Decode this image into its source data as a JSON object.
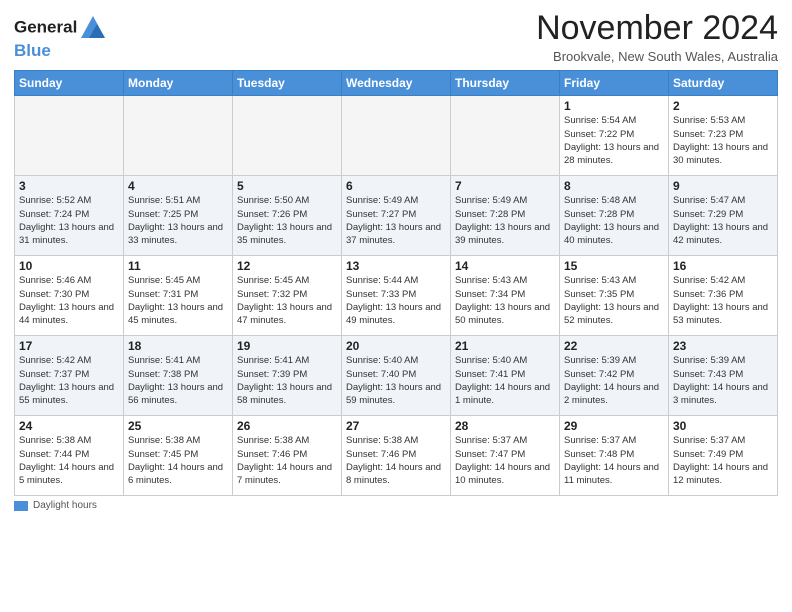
{
  "header": {
    "logo_line1": "General",
    "logo_line2": "Blue",
    "month_title": "November 2024",
    "location": "Brookvale, New South Wales, Australia"
  },
  "calendar": {
    "weekdays": [
      "Sunday",
      "Monday",
      "Tuesday",
      "Wednesday",
      "Thursday",
      "Friday",
      "Saturday"
    ],
    "weeks": [
      [
        {
          "day": "",
          "info": ""
        },
        {
          "day": "",
          "info": ""
        },
        {
          "day": "",
          "info": ""
        },
        {
          "day": "",
          "info": ""
        },
        {
          "day": "",
          "info": ""
        },
        {
          "day": "1",
          "info": "Sunrise: 5:54 AM\nSunset: 7:22 PM\nDaylight: 13 hours and 28 minutes."
        },
        {
          "day": "2",
          "info": "Sunrise: 5:53 AM\nSunset: 7:23 PM\nDaylight: 13 hours and 30 minutes."
        }
      ],
      [
        {
          "day": "3",
          "info": "Sunrise: 5:52 AM\nSunset: 7:24 PM\nDaylight: 13 hours and 31 minutes."
        },
        {
          "day": "4",
          "info": "Sunrise: 5:51 AM\nSunset: 7:25 PM\nDaylight: 13 hours and 33 minutes."
        },
        {
          "day": "5",
          "info": "Sunrise: 5:50 AM\nSunset: 7:26 PM\nDaylight: 13 hours and 35 minutes."
        },
        {
          "day": "6",
          "info": "Sunrise: 5:49 AM\nSunset: 7:27 PM\nDaylight: 13 hours and 37 minutes."
        },
        {
          "day": "7",
          "info": "Sunrise: 5:49 AM\nSunset: 7:28 PM\nDaylight: 13 hours and 39 minutes."
        },
        {
          "day": "8",
          "info": "Sunrise: 5:48 AM\nSunset: 7:28 PM\nDaylight: 13 hours and 40 minutes."
        },
        {
          "day": "9",
          "info": "Sunrise: 5:47 AM\nSunset: 7:29 PM\nDaylight: 13 hours and 42 minutes."
        }
      ],
      [
        {
          "day": "10",
          "info": "Sunrise: 5:46 AM\nSunset: 7:30 PM\nDaylight: 13 hours and 44 minutes."
        },
        {
          "day": "11",
          "info": "Sunrise: 5:45 AM\nSunset: 7:31 PM\nDaylight: 13 hours and 45 minutes."
        },
        {
          "day": "12",
          "info": "Sunrise: 5:45 AM\nSunset: 7:32 PM\nDaylight: 13 hours and 47 minutes."
        },
        {
          "day": "13",
          "info": "Sunrise: 5:44 AM\nSunset: 7:33 PM\nDaylight: 13 hours and 49 minutes."
        },
        {
          "day": "14",
          "info": "Sunrise: 5:43 AM\nSunset: 7:34 PM\nDaylight: 13 hours and 50 minutes."
        },
        {
          "day": "15",
          "info": "Sunrise: 5:43 AM\nSunset: 7:35 PM\nDaylight: 13 hours and 52 minutes."
        },
        {
          "day": "16",
          "info": "Sunrise: 5:42 AM\nSunset: 7:36 PM\nDaylight: 13 hours and 53 minutes."
        }
      ],
      [
        {
          "day": "17",
          "info": "Sunrise: 5:42 AM\nSunset: 7:37 PM\nDaylight: 13 hours and 55 minutes."
        },
        {
          "day": "18",
          "info": "Sunrise: 5:41 AM\nSunset: 7:38 PM\nDaylight: 13 hours and 56 minutes."
        },
        {
          "day": "19",
          "info": "Sunrise: 5:41 AM\nSunset: 7:39 PM\nDaylight: 13 hours and 58 minutes."
        },
        {
          "day": "20",
          "info": "Sunrise: 5:40 AM\nSunset: 7:40 PM\nDaylight: 13 hours and 59 minutes."
        },
        {
          "day": "21",
          "info": "Sunrise: 5:40 AM\nSunset: 7:41 PM\nDaylight: 14 hours and 1 minute."
        },
        {
          "day": "22",
          "info": "Sunrise: 5:39 AM\nSunset: 7:42 PM\nDaylight: 14 hours and 2 minutes."
        },
        {
          "day": "23",
          "info": "Sunrise: 5:39 AM\nSunset: 7:43 PM\nDaylight: 14 hours and 3 minutes."
        }
      ],
      [
        {
          "day": "24",
          "info": "Sunrise: 5:38 AM\nSunset: 7:44 PM\nDaylight: 14 hours and 5 minutes."
        },
        {
          "day": "25",
          "info": "Sunrise: 5:38 AM\nSunset: 7:45 PM\nDaylight: 14 hours and 6 minutes."
        },
        {
          "day": "26",
          "info": "Sunrise: 5:38 AM\nSunset: 7:46 PM\nDaylight: 14 hours and 7 minutes."
        },
        {
          "day": "27",
          "info": "Sunrise: 5:38 AM\nSunset: 7:46 PM\nDaylight: 14 hours and 8 minutes."
        },
        {
          "day": "28",
          "info": "Sunrise: 5:37 AM\nSunset: 7:47 PM\nDaylight: 14 hours and 10 minutes."
        },
        {
          "day": "29",
          "info": "Sunrise: 5:37 AM\nSunset: 7:48 PM\nDaylight: 14 hours and 11 minutes."
        },
        {
          "day": "30",
          "info": "Sunrise: 5:37 AM\nSunset: 7:49 PM\nDaylight: 14 hours and 12 minutes."
        }
      ]
    ]
  },
  "footer": {
    "legend_label": "Daylight hours"
  }
}
